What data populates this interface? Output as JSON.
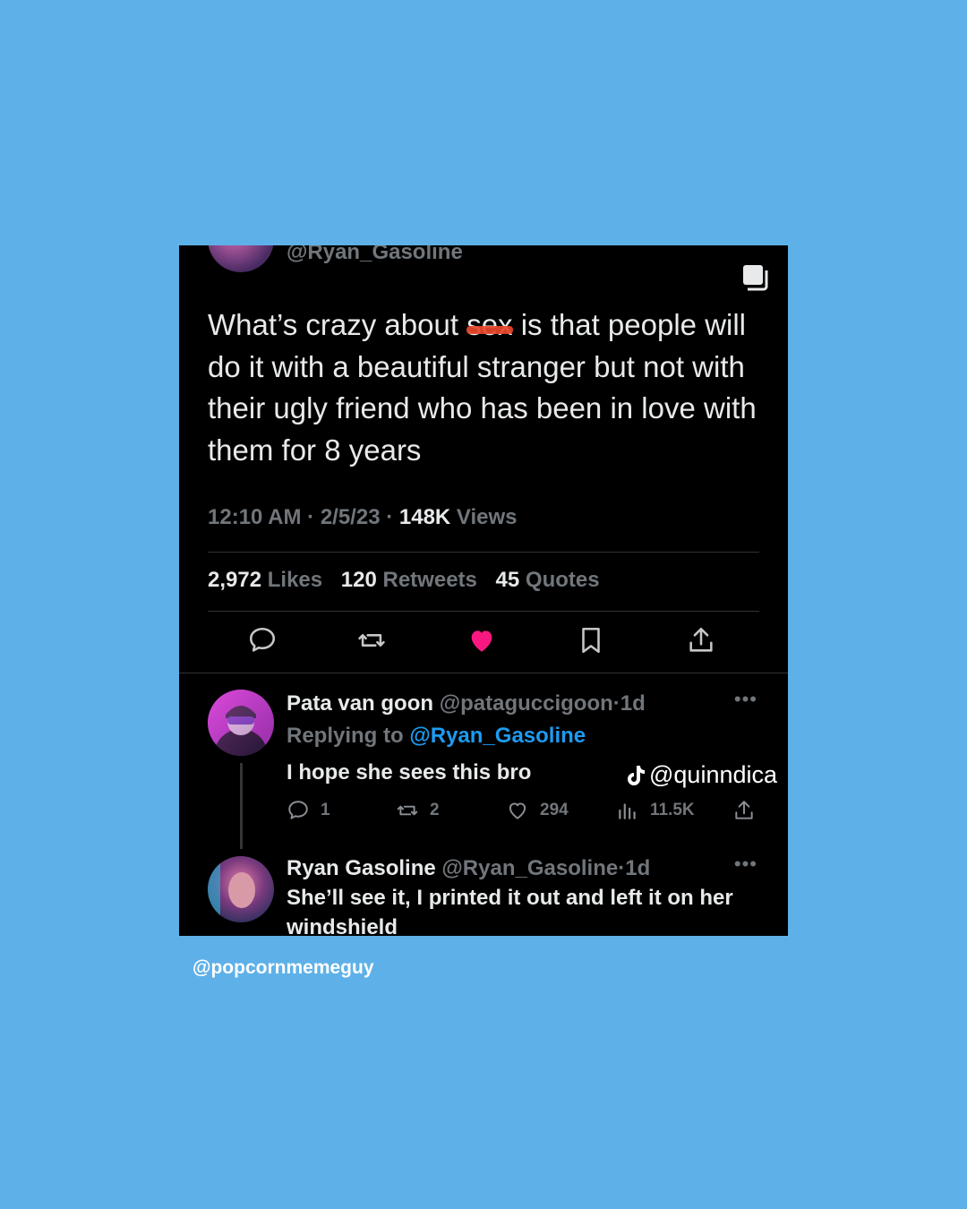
{
  "main_tweet": {
    "handle": "@Ryan_Gasoline",
    "text_before": "What’s crazy about ",
    "redacted_word": "sex",
    "text_after": " is that people will do it with a beautiful stranger but not with their ugly friend who has been in love with them for 8 years",
    "time": "12:10 AM",
    "date": "2/5/23",
    "views_count": "148K",
    "views_label": "Views",
    "likes_count": "2,972",
    "likes_label": "Likes",
    "retweets_count": "120",
    "retweets_label": "Retweets",
    "quotes_count": "45",
    "quotes_label": "Quotes",
    "like_color": "#f91880"
  },
  "replies": [
    {
      "name": "Pata van goon",
      "handle": "@pataguccigoon",
      "age": "1d",
      "replying_prefix": "Replying to",
      "replying_to": "@Ryan_Gasoline",
      "text": "I hope she sees this bro",
      "reply_count": "1",
      "retweet_count": "2",
      "like_count": "294",
      "views_count": "11.5K"
    },
    {
      "name": "Ryan Gasoline",
      "handle": "@Ryan_Gasoline",
      "age": "1d",
      "text": "She’ll see it, I printed it out and left it on her windshield"
    }
  ],
  "watermark": {
    "handle": "@quinndica",
    "icon": "tiktok-icon"
  },
  "credit": "@popcornmemeguy",
  "colors": {
    "background": "#5eb1e8",
    "card": "#000000",
    "link": "#1d9bf0"
  }
}
